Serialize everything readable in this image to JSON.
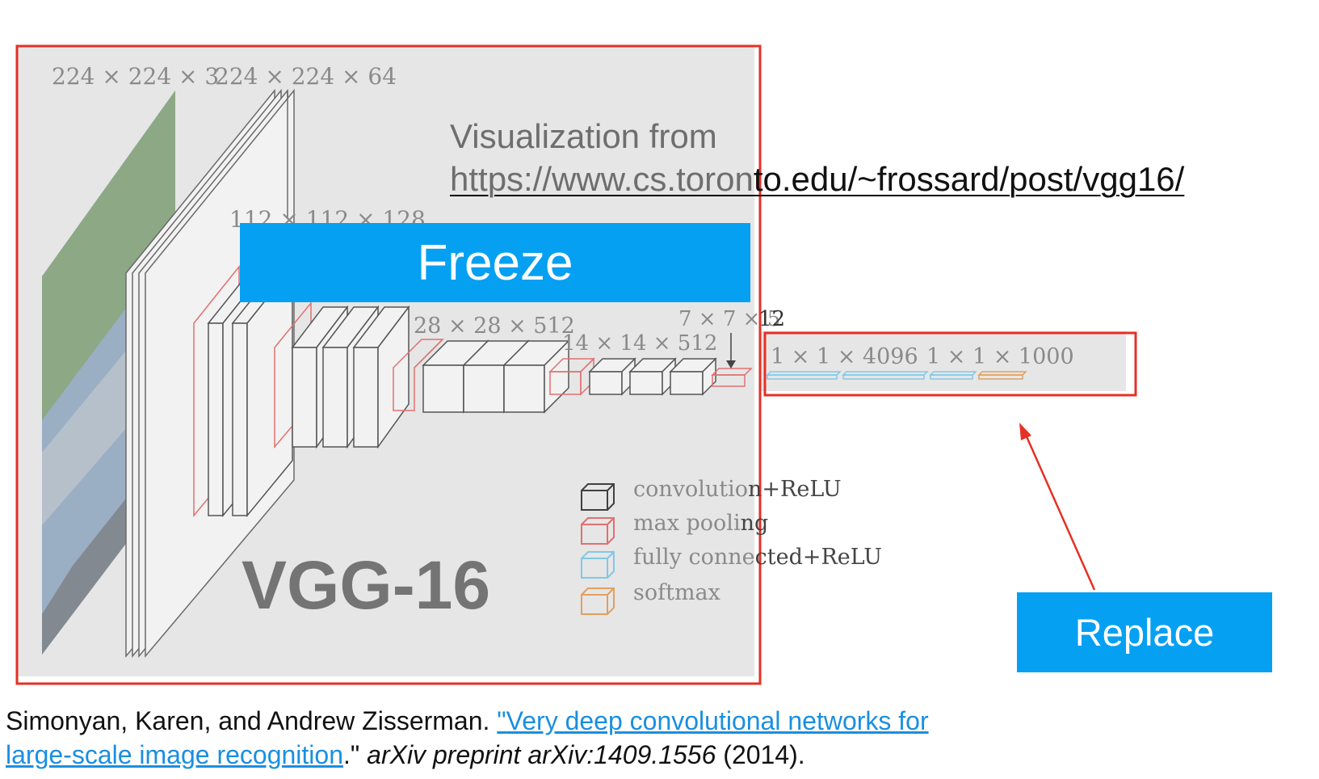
{
  "visualization": {
    "label": "Visualization from",
    "url_part1": "https://www.cs.toron",
    "url_part2": "to.edu/~frossard/post/vgg16/"
  },
  "buttons": {
    "freeze": "Freeze",
    "replace": "Replace"
  },
  "model_title": "VGG-16",
  "dimension_labels": {
    "input": "224 × 224 × 3",
    "conv1": "224 × 224 × 64",
    "conv2": "112 × 112 × 128",
    "conv4": "28 × 28 × 512",
    "conv5": "14 × 14 × 512",
    "pool5_a": "7 × 7 × 5",
    "pool5_b": "12",
    "fc1": "1 × 1 × 4096",
    "fc3": "1 × 1 × 1000"
  },
  "legend": [
    {
      "label_a": "convolutio",
      "label_b": "n+ReLU",
      "color": "#404040"
    },
    {
      "label_a": "max  pooli",
      "label_b": "ng",
      "color": "#e07070"
    },
    {
      "label_a": "fully  conne",
      "label_b": "cted+ReLU",
      "color": "#80c8e8"
    },
    {
      "label_a": "softmax",
      "label_b": "",
      "color": "#e0a060"
    }
  ],
  "citation": {
    "authors": "Simonyan, Karen, and Andrew Zisserman. ",
    "quote_open": "\"",
    "title_line1": "Very deep convolutional networks for",
    "title_line2": "large-scale image recognition",
    "quote_close": ".\" ",
    "venue": "arXiv preprint arXiv:1409.1556",
    "year": " (2014)."
  },
  "colors": {
    "accent_blue": "#06a0f2",
    "highlight_red": "#e53025",
    "panel_gray": "#e6e6e6"
  }
}
